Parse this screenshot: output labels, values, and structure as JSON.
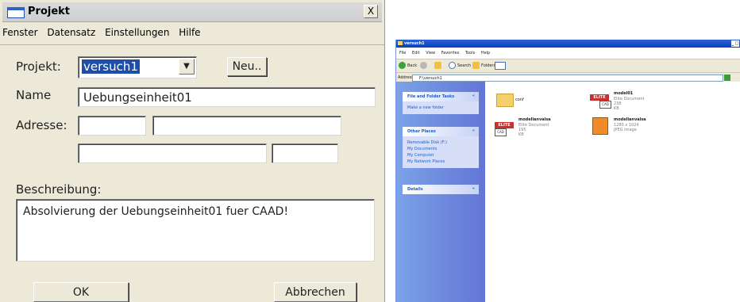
{
  "dialog": {
    "title": "Projekt",
    "close_label": "X",
    "menu": [
      "Fenster",
      "Datensatz",
      "Einstellungen",
      "Hilfe"
    ],
    "projekt_label": "Projekt:",
    "projekt_value": "versuch1",
    "combo_arrow": "▼",
    "neu_label": "Neu..",
    "name_label": "Name",
    "name_value": "Uebungseinheit01",
    "adresse_label": "Adresse:",
    "adresse_fields": [
      "",
      "",
      "",
      ""
    ],
    "beschreibung_label": "Beschreibung:",
    "beschreibung_value": "Absolvierung der Uebungseinheit01 fuer CAAD!",
    "ok_label": "OK",
    "abbrechen_label": "Abbrechen"
  },
  "explorer": {
    "title": "versuch1",
    "window_controls": "_ □",
    "menu": [
      "File",
      "Edit",
      "View",
      "Favorites",
      "Tools",
      "Help"
    ],
    "toolbar": {
      "back": "Back",
      "search": "Search",
      "folders": "Folders"
    },
    "address_label": "Address",
    "address_value": "F:\\versuch1",
    "go_label": "Go",
    "tasks_panel": {
      "title": "File and Folder Tasks",
      "items": [
        "Make a new folder"
      ]
    },
    "places_panel": {
      "title": "Other Places",
      "items": [
        "Removable Disk (F:)",
        "My Documents",
        "My Computer",
        "My Network Places"
      ]
    },
    "details_panel": {
      "title": "Details"
    },
    "panel_chevron": "«",
    "files": [
      {
        "name": "conf",
        "detail1": "",
        "detail2": "",
        "icon": "folder-icon"
      },
      {
        "name": "model01",
        "detail1": "Elite Document",
        "detail2": "238 KB",
        "icon": "elite-cad-icon"
      },
      {
        "name": "modellanvalsa",
        "detail1": "Elite Document",
        "detail2": "195 KB",
        "icon": "elite-cad-icon"
      },
      {
        "name": "modellanvalsa",
        "detail1": "1280 x 1024",
        "detail2": "JPEG Image",
        "icon": "image-icon"
      }
    ],
    "elite_logo": "ELITE",
    "cad_logo": "CAD"
  }
}
